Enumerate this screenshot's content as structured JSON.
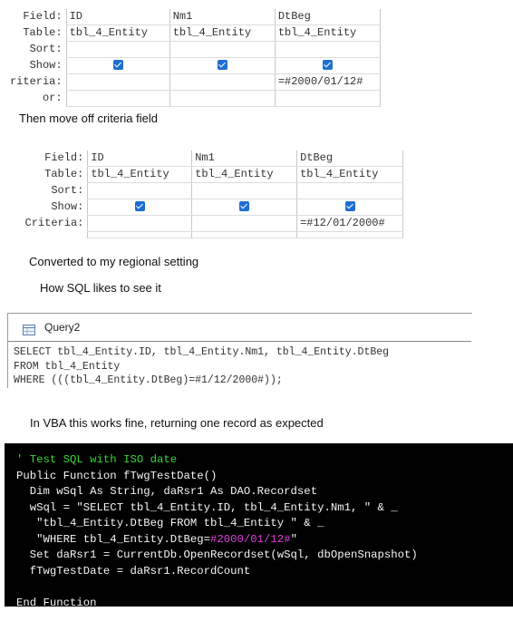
{
  "grid1": {
    "labels": {
      "field": "Field:",
      "table": "Table:",
      "sort": "Sort:",
      "show": "Show:",
      "criteria": "riteria:",
      "or": "or:"
    },
    "columns": [
      {
        "field": "ID",
        "table": "tbl_4_Entity",
        "show": true,
        "criteria": ""
      },
      {
        "field": "Nm1",
        "table": "tbl_4_Entity",
        "show": true,
        "criteria": ""
      },
      {
        "field": "DtBeg",
        "table": "tbl_4_Entity",
        "show": true,
        "criteria": "=#2000/01/12#"
      }
    ]
  },
  "caption1": "Then move off criteria field",
  "grid2": {
    "labels": {
      "field": "Field:",
      "table": "Table:",
      "sort": "Sort:",
      "show": "Show:",
      "criteria": "Criteria:"
    },
    "columns": [
      {
        "field": "ID",
        "table": "tbl_4_Entity",
        "show": true,
        "criteria": ""
      },
      {
        "field": "Nm1",
        "table": "tbl_4_Entity",
        "show": true,
        "criteria": ""
      },
      {
        "field": "DtBeg",
        "table": "tbl_4_Entity",
        "show": true,
        "criteria": "=#12/01/2000#"
      }
    ]
  },
  "caption2": "Converted to my regional setting",
  "caption3": "How SQL likes to see it",
  "query_window": {
    "title": "Query2",
    "sql_lines": [
      "SELECT tbl_4_Entity.ID, tbl_4_Entity.Nm1, tbl_4_Entity.DtBeg",
      "FROM tbl_4_Entity",
      "WHERE (((tbl_4_Entity.DtBeg)=#1/12/2000#));"
    ]
  },
  "caption4": "In VBA this works fine, returning one record as expected",
  "vba": {
    "comment": "' Test SQL with ISO date",
    "l1": "Public Function fTwgTestDate()",
    "l2": "  Dim wSql As String, daRsr1 As DAO.Recordset",
    "l3": "  wSql = \"SELECT tbl_4_Entity.ID, tbl_4_Entity.Nm1, \" & _",
    "l4": "   \"tbl_4_Entity.DtBeg FROM tbl_4_Entity \" & _",
    "l5a": "   \"WHERE tbl_4_Entity.DtBeg=",
    "l5b": "#2000/01/12#",
    "l5c": "\"",
    "l6": "  Set daRsr1 = CurrentDb.OpenRecordset(wSql, dbOpenSnapshot)",
    "l7": "  fTwgTestDate = daRsr1.RecordCount",
    "l8": "",
    "l9": "End Function"
  }
}
